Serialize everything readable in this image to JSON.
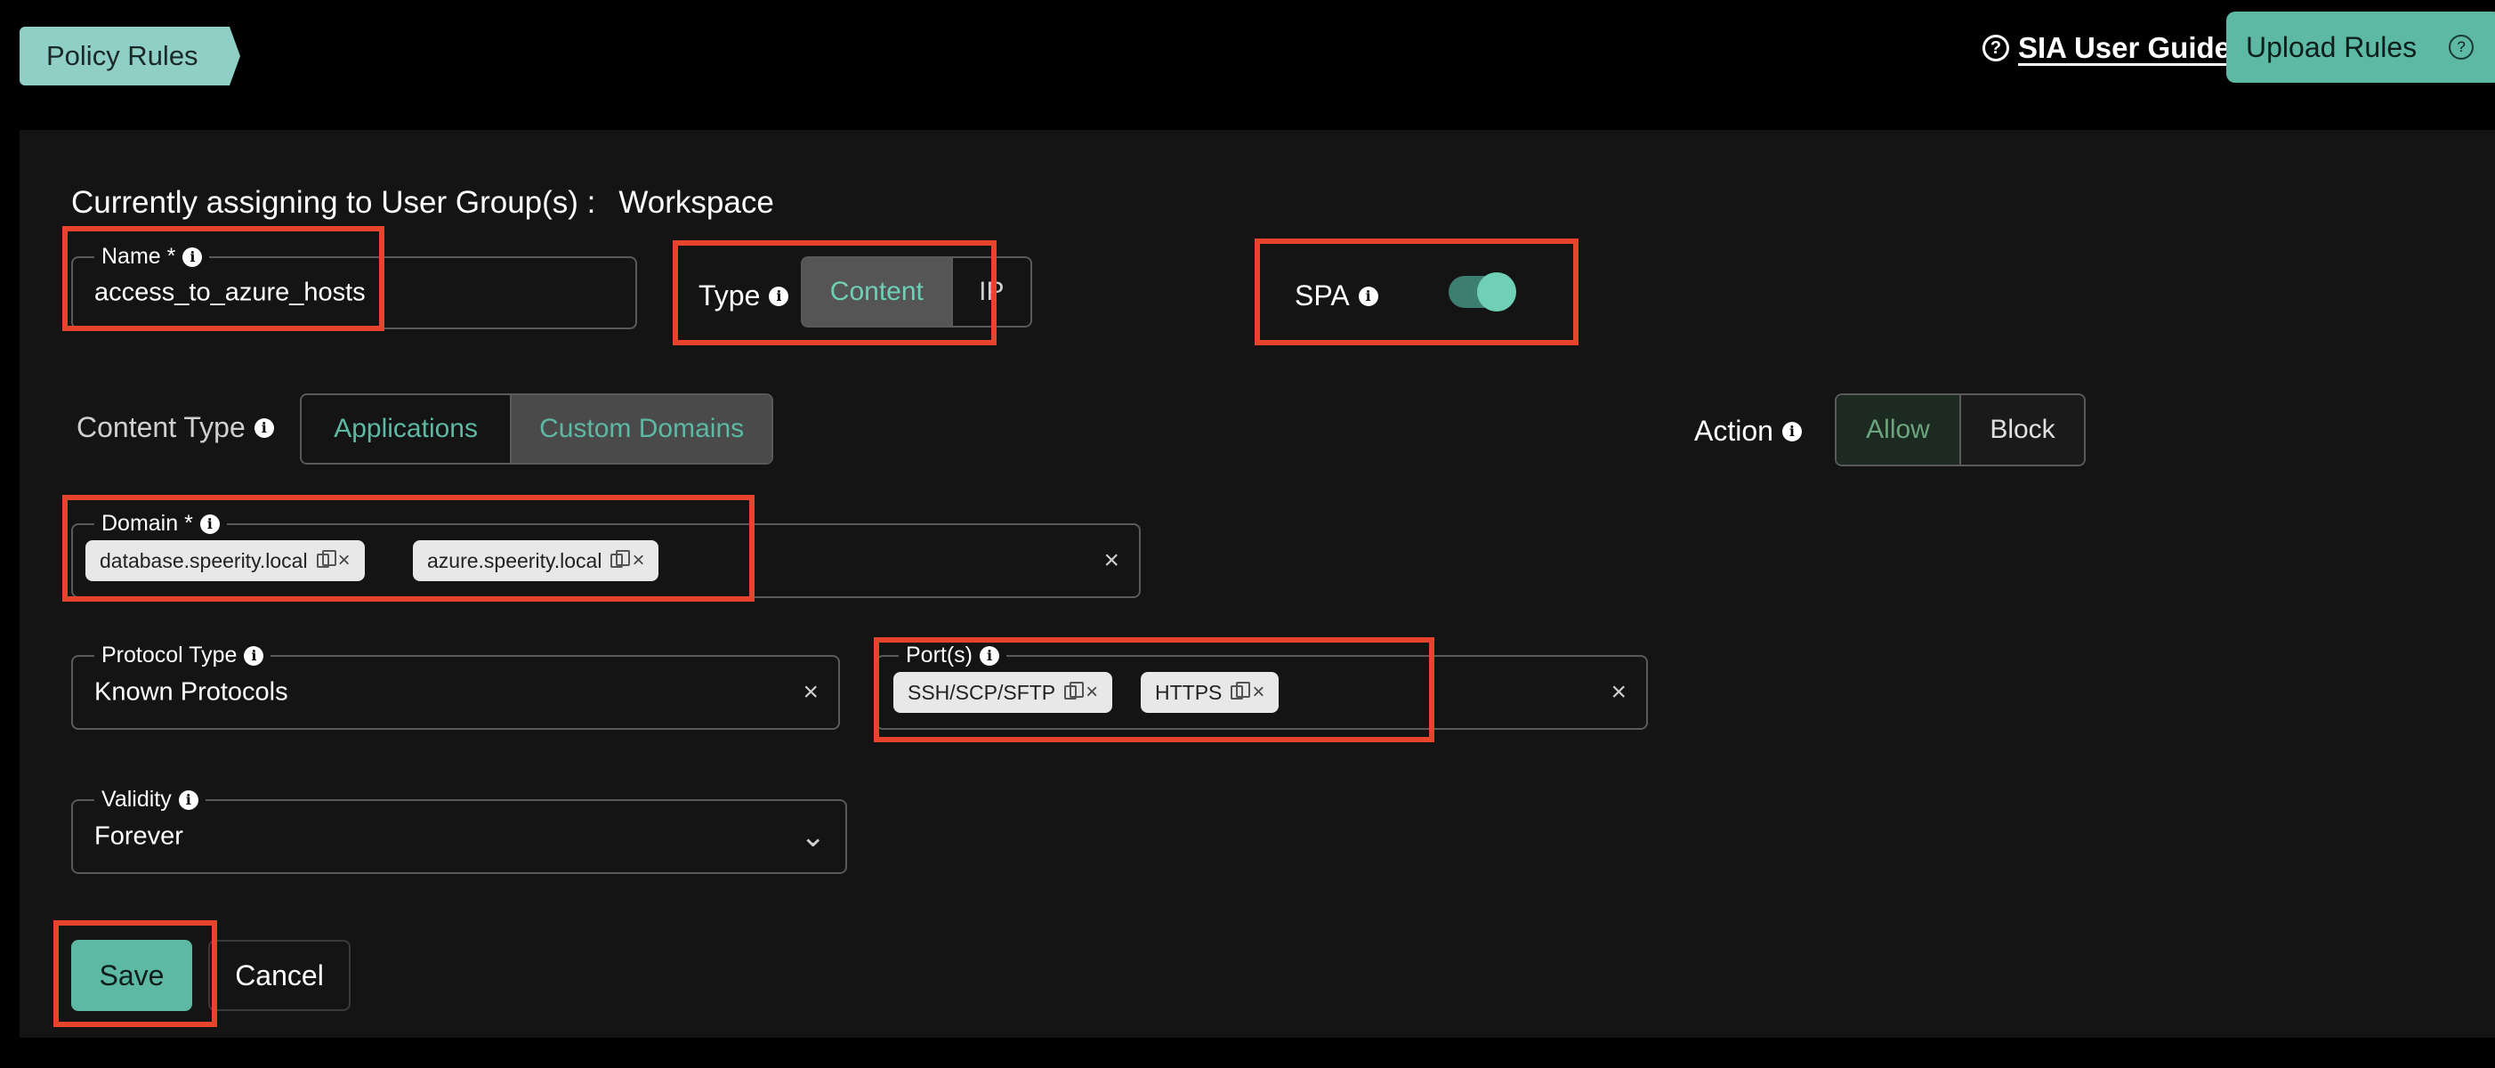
{
  "header": {
    "breadcrumb": "Policy Rules",
    "guide_label": "SIA User Guide",
    "guide_icon": "?",
    "upload_label": "Upload Rules",
    "upload_icon": "?"
  },
  "form": {
    "assign_label": "Currently assigning to User Group(s) :",
    "assign_value": "Workspace",
    "name": {
      "label": "Name *",
      "value": "access_to_azure_hosts"
    },
    "type": {
      "label": "Type",
      "options": [
        "Content",
        "IP"
      ],
      "selected": "Content"
    },
    "spa": {
      "label": "SPA",
      "enabled": true
    },
    "content_type": {
      "label": "Content Type",
      "options": [
        "Applications",
        "Custom Domains"
      ],
      "selected": "Custom Domains"
    },
    "action": {
      "label": "Action",
      "options": [
        "Allow",
        "Block"
      ],
      "selected": "Allow"
    },
    "domain": {
      "label": "Domain *",
      "chips": [
        "database.speerity.local",
        "azure.speerity.local"
      ],
      "clear": "×"
    },
    "protocol_type": {
      "label": "Protocol Type",
      "value": "Known Protocols",
      "clear": "×"
    },
    "ports": {
      "label": "Port(s)",
      "chips": [
        "SSH/SCP/SFTP",
        "HTTPS"
      ],
      "clear": "×"
    },
    "validity": {
      "label": "Validity",
      "value": "Forever"
    },
    "chip_close": "×",
    "info_glyph": "i",
    "chevron": "⌄"
  },
  "buttons": {
    "save": "Save",
    "cancel": "Cancel"
  },
  "colors": {
    "accent": "#5db8a4",
    "breadcrumb_bg": "#8fcfc5",
    "highlight": "#e8432d",
    "panel_bg": "#141414"
  }
}
